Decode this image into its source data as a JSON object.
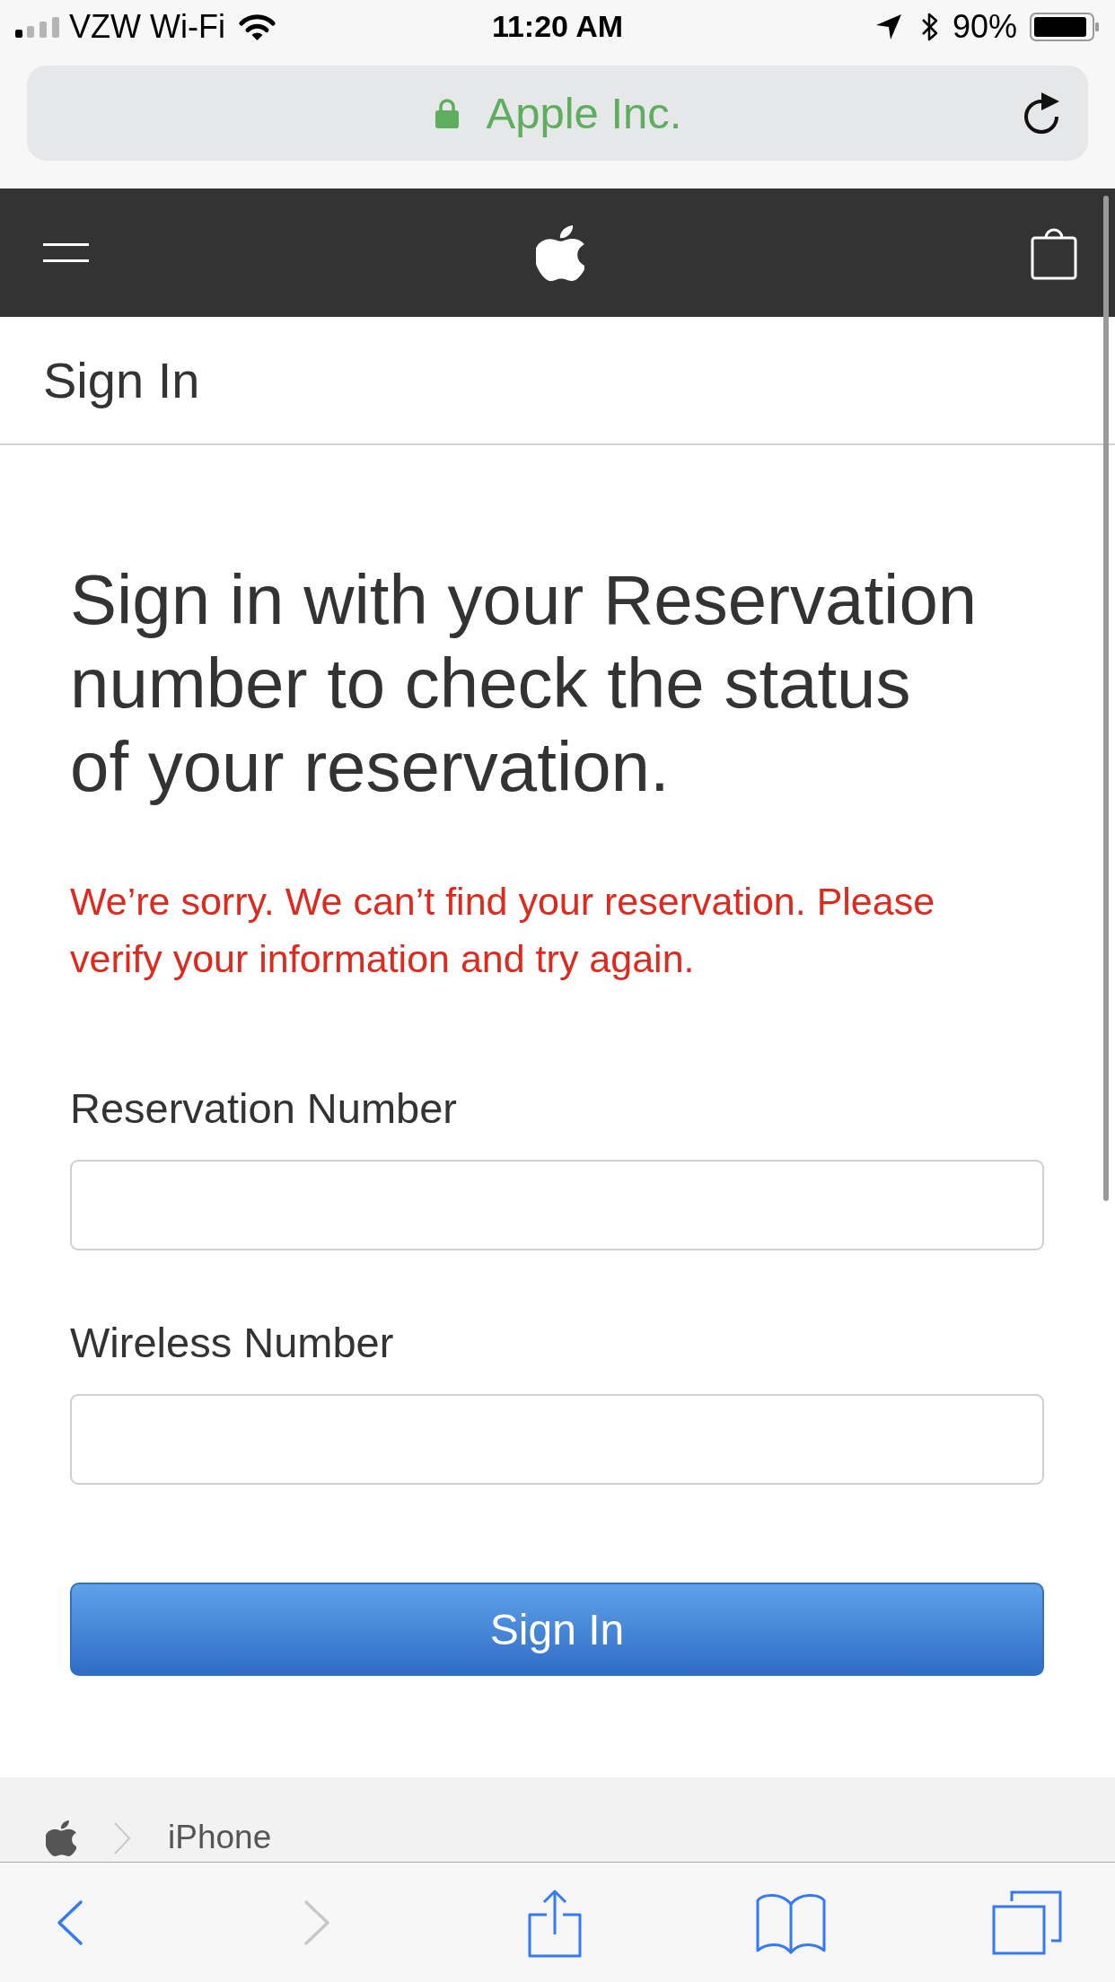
{
  "status_bar": {
    "carrier": "VZW Wi-Fi",
    "time": "11:20 AM",
    "battery": "90%"
  },
  "address_bar": {
    "site": "Apple Inc."
  },
  "page_header": {
    "title": "Sign In"
  },
  "form": {
    "heading": "Sign in with your Reservation number to check the status of your reservation.",
    "error": "We’re sorry. We can’t find your reservation. Please verify your information and try again.",
    "fields": [
      {
        "label": "Reservation Number"
      },
      {
        "label": "Wireless Number"
      }
    ],
    "submit": "Sign In"
  },
  "breadcrumb": {
    "items": [
      "iPhone"
    ]
  },
  "toolbar": {
    "items": [
      {
        "kind": "back",
        "disabled": false
      },
      {
        "kind": "forward",
        "disabled": true
      },
      {
        "kind": "share",
        "disabled": false
      },
      {
        "kind": "bookmarks",
        "disabled": false
      },
      {
        "kind": "tabs",
        "disabled": false
      }
    ]
  }
}
